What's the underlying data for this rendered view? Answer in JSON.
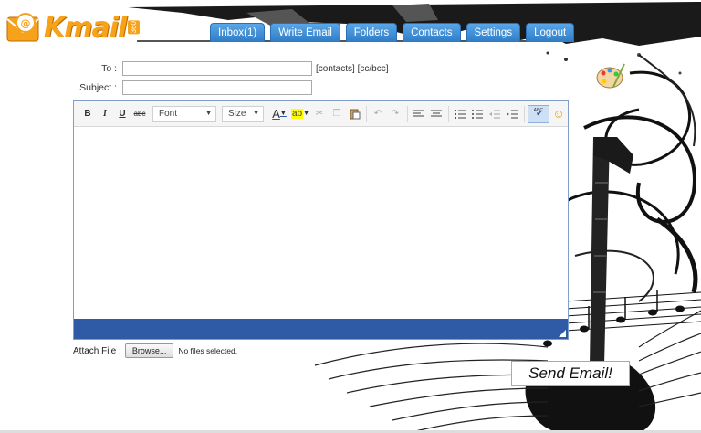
{
  "app": {
    "logo_text": "Kmail",
    "logo_badge": "360"
  },
  "tabs": [
    {
      "label": "Inbox(1)"
    },
    {
      "label": "Write Email"
    },
    {
      "label": "Folders"
    },
    {
      "label": "Contacts"
    },
    {
      "label": "Settings"
    },
    {
      "label": "Logout"
    }
  ],
  "form": {
    "to_label": "To :",
    "to_value": "",
    "to_links": "[contacts] [cc/bcc]",
    "subject_label": "Subject :",
    "subject_value": ""
  },
  "toolbar": {
    "bold": "B",
    "italic": "I",
    "underline": "U",
    "strike": "abc",
    "font_label": "Font",
    "size_label": "Size",
    "text_color": "A",
    "bg_color": "ab",
    "spell": "ABC"
  },
  "attach": {
    "label": "Attach File :",
    "browse_label": "Browse...",
    "status": "No files selected."
  },
  "send": {
    "label": "Send Email!"
  },
  "colors": {
    "tab": "#3f8fd8",
    "editor_footer": "#2e5aa6",
    "logo": "#f7a21b"
  }
}
